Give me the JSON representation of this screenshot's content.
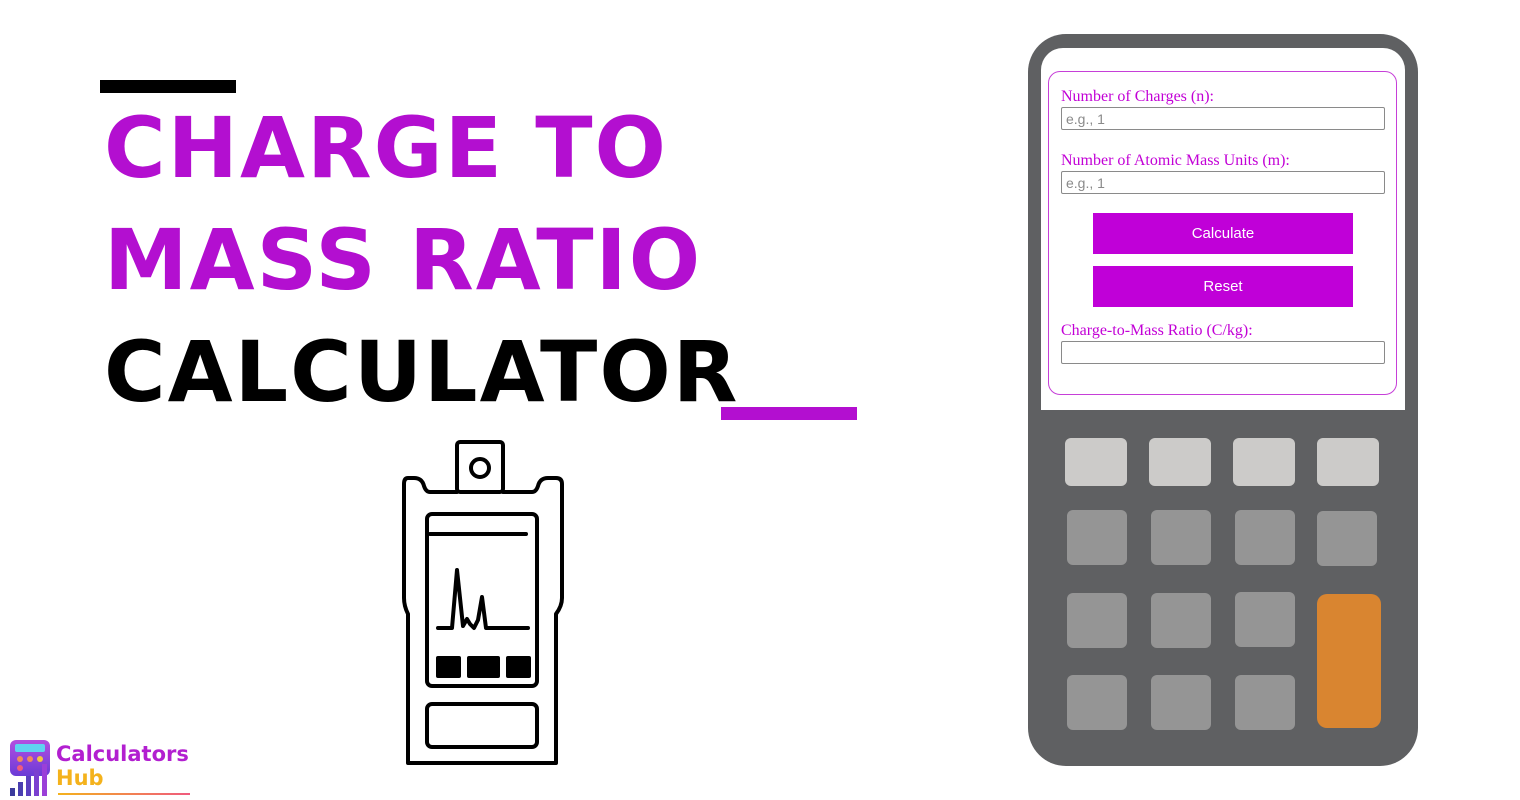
{
  "title": {
    "line1": "Charge to",
    "line2": "Mass Ratio",
    "line3": "Calculator",
    "accent_color": "#b30fd0",
    "text_color": "#000000"
  },
  "illustration": {
    "icon": "mass-spectrometer-icon"
  },
  "calculator": {
    "fields": [
      {
        "label": "Number of Charges (n):",
        "placeholder": "e.g., 1",
        "value": ""
      },
      {
        "label": "Number of Atomic Mass Units (m):",
        "placeholder": "e.g., 1",
        "value": ""
      }
    ],
    "calculate_label": "Calculate",
    "reset_label": "Reset",
    "result_label": "Charge-to-Mass Ratio (C/kg):",
    "result_value": "",
    "button_color": "#c000d8"
  },
  "brand": {
    "name_line1": "Calculators",
    "name_line2": "Hub"
  }
}
